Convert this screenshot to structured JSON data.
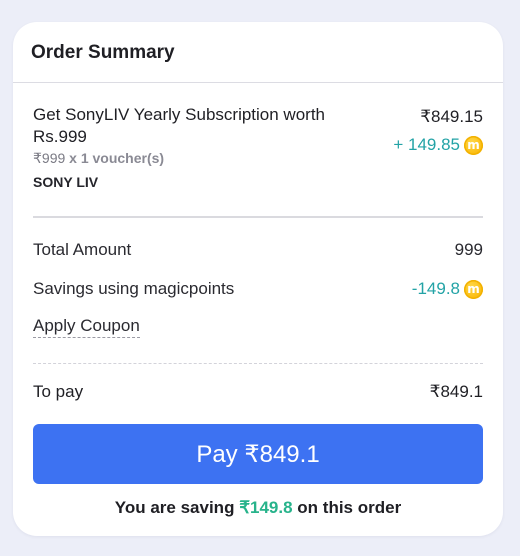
{
  "order_summary": {
    "title": "Order Summary",
    "product": {
      "name": "Get SonyLIV Yearly Subscription worth Rs.999",
      "unit_price": "₹999",
      "quantity_text": "x 1 voucher(s)",
      "brand": "SONY LIV",
      "price": "₹849.15",
      "points": "+ 149.85",
      "points_icon": "magicpoints-coin-icon"
    },
    "total_amount": {
      "label": "Total Amount",
      "value": "999"
    },
    "savings": {
      "label": "Savings using magicpoints",
      "value": "-149.8",
      "icon": "magicpoints-coin-icon"
    },
    "apply_coupon_label": "Apply Coupon",
    "to_pay": {
      "label": "To pay",
      "value": "₹849.1"
    },
    "pay_button_label": "Pay ₹849.1",
    "saving_note": {
      "prefix": "You are saving",
      "amount": "₹149.8",
      "suffix": "on this order"
    }
  },
  "colors": {
    "background": "#eceef8",
    "accent_teal": "#23a3a6",
    "pay_button": "#3d72f2",
    "saving_green": "#27b38b",
    "coin_gold": "#fbbd12"
  }
}
